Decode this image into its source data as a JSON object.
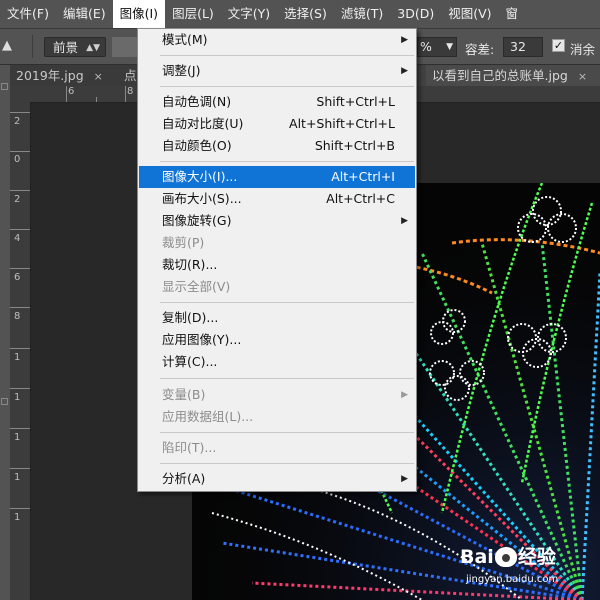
{
  "menubar": {
    "items": [
      {
        "label": "文件(F)"
      },
      {
        "label": "编辑(E)"
      },
      {
        "label": "图像(I)",
        "active": true
      },
      {
        "label": "图层(L)"
      },
      {
        "label": "文字(Y)"
      },
      {
        "label": "选择(S)"
      },
      {
        "label": "滤镜(T)"
      },
      {
        "label": "3D(D)"
      },
      {
        "label": "视图(V)"
      },
      {
        "label": "窗"
      }
    ]
  },
  "options_bar": {
    "fill_source": "前景",
    "opacity_value": "%",
    "tolerance_label": "容差:",
    "tolerance_value": "32",
    "anti_alias_label": "消余",
    "anti_alias_checked": "✓"
  },
  "tabs": [
    {
      "label": "2019年.jpg",
      "close": "×"
    },
    {
      "label": "点"
    },
    {
      "label": "以看到自己的总账单.jpg",
      "close": "×"
    }
  ],
  "rulers": {
    "h_numbers": [
      "6",
      "8"
    ],
    "v_numbers": [
      "2",
      "0",
      "2",
      "4",
      "6",
      "8",
      "1",
      "1",
      "1",
      "1",
      "1"
    ]
  },
  "image_menu": {
    "groups": [
      [
        {
          "label": "模式(M)",
          "submenu": true
        }
      ],
      [
        {
          "label": "调整(J)",
          "submenu": true
        }
      ],
      [
        {
          "label": "自动色调(N)",
          "shortcut": "Shift+Ctrl+L"
        },
        {
          "label": "自动对比度(U)",
          "shortcut": "Alt+Shift+Ctrl+L"
        },
        {
          "label": "自动颜色(O)",
          "shortcut": "Shift+Ctrl+B"
        }
      ],
      [
        {
          "label": "图像大小(I)...",
          "shortcut": "Alt+Ctrl+I",
          "highlighted": true
        },
        {
          "label": "画布大小(S)...",
          "shortcut": "Alt+Ctrl+C"
        },
        {
          "label": "图像旋转(G)",
          "submenu": true
        },
        {
          "label": "裁剪(P)",
          "disabled": true
        },
        {
          "label": "裁切(R)..."
        },
        {
          "label": "显示全部(V)",
          "disabled": true
        }
      ],
      [
        {
          "label": "复制(D)..."
        },
        {
          "label": "应用图像(Y)..."
        },
        {
          "label": "计算(C)..."
        }
      ],
      [
        {
          "label": "变量(B)",
          "submenu": true,
          "disabled": true
        },
        {
          "label": "应用数据组(L)...",
          "disabled": true
        }
      ],
      [
        {
          "label": "陷印(T)...",
          "disabled": true
        }
      ],
      [
        {
          "label": "分析(A)",
          "submenu": true
        }
      ]
    ]
  },
  "watermark": {
    "brand_left": "Bai",
    "brand_right": "经验",
    "url": "jingyan.baidu.com"
  },
  "colors": {
    "menu_highlight": "#0f74d6",
    "ui_panel": "#535353",
    "canvas_bg": "#282828"
  }
}
